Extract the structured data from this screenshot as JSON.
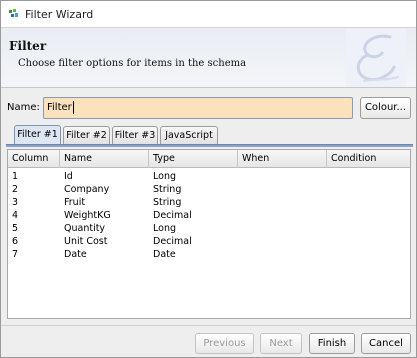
{
  "window": {
    "title": "Filter Wizard",
    "app_icon": "wizard-app-icon"
  },
  "banner": {
    "heading": "Filter",
    "subheading": "Choose filter options for items in the schema",
    "logo_icon": "script-e-logo-icon"
  },
  "name_field": {
    "label": "Name:",
    "value": "Filter",
    "colour_button": "Colour..."
  },
  "tabs": [
    {
      "label": "Filter #1",
      "active": true
    },
    {
      "label": "Filter #2",
      "active": false
    },
    {
      "label": "Filter #3",
      "active": false
    },
    {
      "label": "JavaScript",
      "active": false
    }
  ],
  "table": {
    "columns": [
      "Column",
      "Name",
      "Type",
      "When",
      "Condition"
    ],
    "rows": [
      [
        "1",
        "Id",
        "Long",
        "",
        ""
      ],
      [
        "2",
        "Company",
        "String",
        "",
        ""
      ],
      [
        "3",
        "Fruit",
        "String",
        "",
        ""
      ],
      [
        "4",
        "WeightKG",
        "Decimal",
        "",
        ""
      ],
      [
        "5",
        "Quantity",
        "Long",
        "",
        ""
      ],
      [
        "6",
        "Unit Cost",
        "Decimal",
        "",
        ""
      ],
      [
        "7",
        "Date",
        "Date",
        "",
        ""
      ]
    ]
  },
  "footer": {
    "previous": "Previous",
    "next": "Next",
    "finish": "Finish",
    "cancel": "Cancel"
  },
  "colors": {
    "name_input_bg": "#fae2bc",
    "active_tab_underline": "#8aa2c6"
  }
}
